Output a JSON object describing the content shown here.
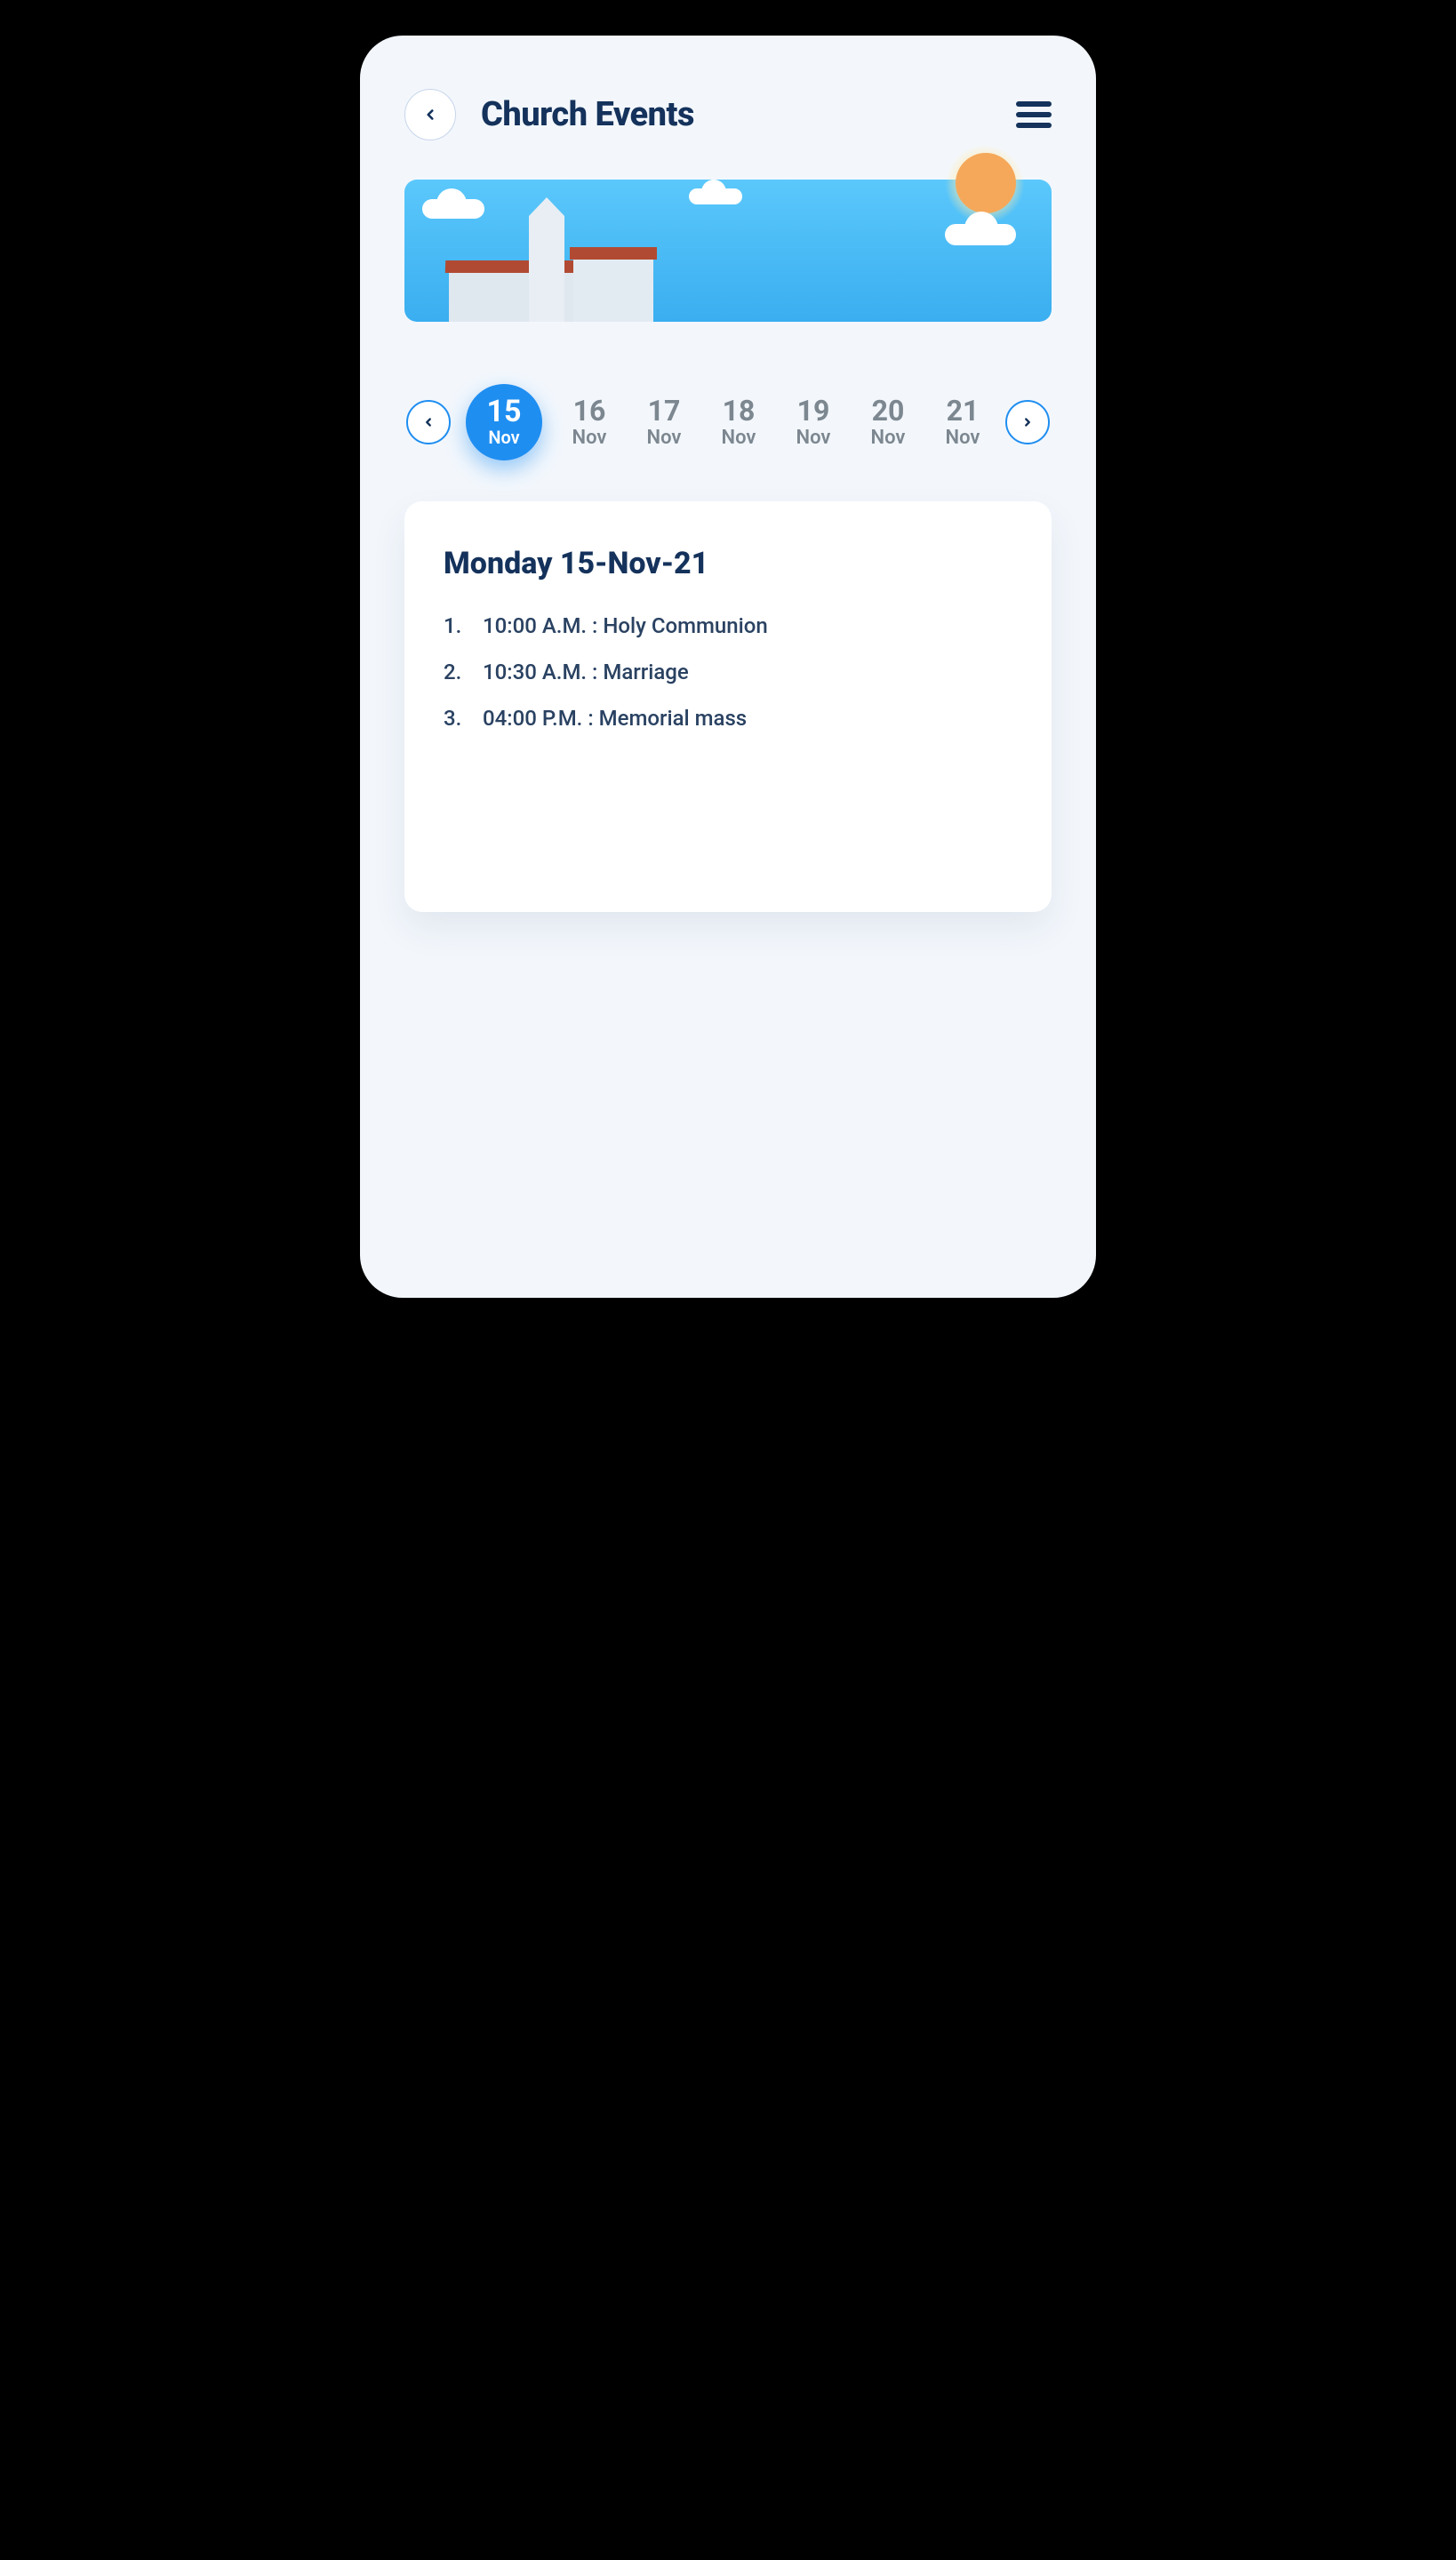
{
  "header": {
    "title": "Church Events"
  },
  "dateStrip": {
    "items": [
      {
        "day": "15",
        "month": "Nov",
        "active": true
      },
      {
        "day": "16",
        "month": "Nov",
        "active": false
      },
      {
        "day": "17",
        "month": "Nov",
        "active": false
      },
      {
        "day": "18",
        "month": "Nov",
        "active": false
      },
      {
        "day": "19",
        "month": "Nov",
        "active": false
      },
      {
        "day": "20",
        "month": "Nov",
        "active": false
      },
      {
        "day": "21",
        "month": "Nov",
        "active": false
      }
    ]
  },
  "eventsCard": {
    "title": "Monday 15-Nov-21",
    "events": [
      {
        "index": "1.",
        "text": "10:00 A.M. : Holy Communion"
      },
      {
        "index": "2.",
        "text": "10:30 A.M. : Marriage"
      },
      {
        "index": "3.",
        "text": "04:00 P.M. : Memorial mass"
      }
    ]
  }
}
